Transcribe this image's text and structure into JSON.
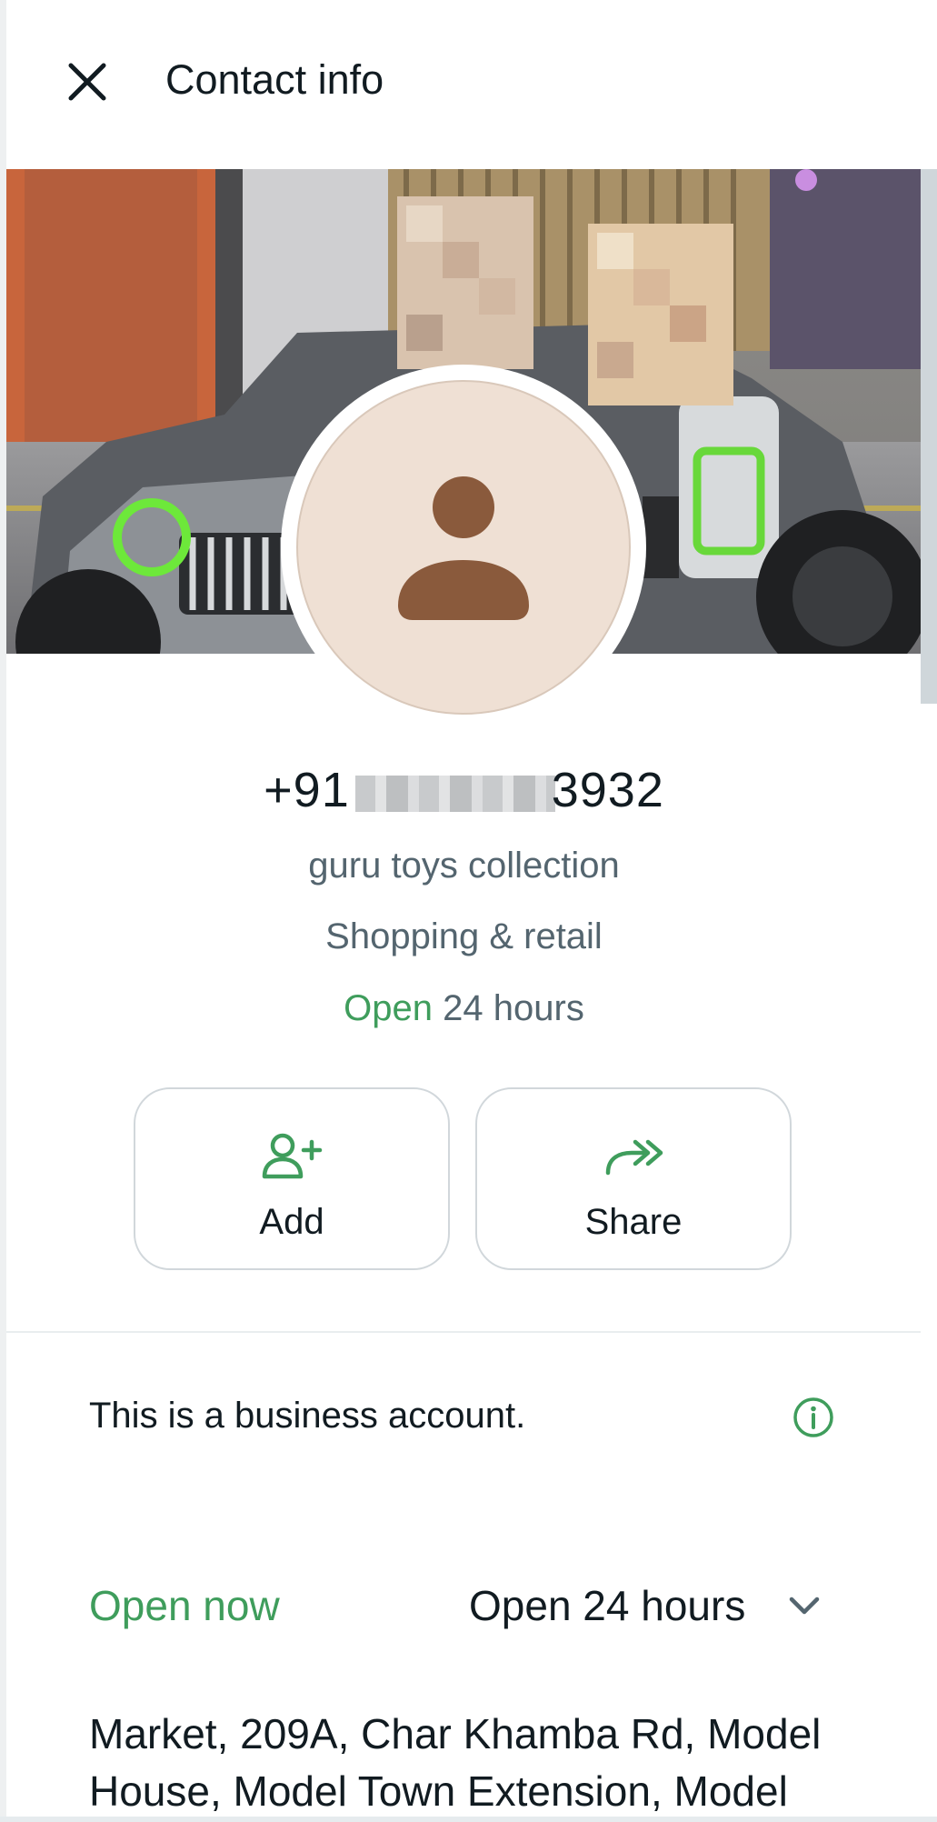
{
  "header": {
    "title": "Contact info",
    "close_icon": "close-icon"
  },
  "profile": {
    "phone_prefix": "+91",
    "phone_suffix": "3932",
    "business_name": "guru toys collection",
    "category": "Shopping & retail",
    "hours_open_word": "Open",
    "hours_rest": "24 hours"
  },
  "actions": [
    {
      "label": "Add",
      "icon": "add-contact-icon"
    },
    {
      "label": "Share",
      "icon": "share-icon"
    }
  ],
  "business_note": {
    "text": "This is a business account.",
    "icon": "info-icon"
  },
  "business_hours": {
    "status": "Open now",
    "hours": "Open 24 hours",
    "icon": "chevron-down-icon"
  },
  "address": {
    "text": "Market, 209A, Char Khamba Rd, Model House, Model Town Extension, Model"
  },
  "colors": {
    "accent": "#3f9d5c",
    "text_primary": "#111b21",
    "text_secondary": "#54656f",
    "border": "#d1d7db",
    "avatar_bg": "#efe0d4",
    "avatar_fg": "#8a5a3c"
  }
}
